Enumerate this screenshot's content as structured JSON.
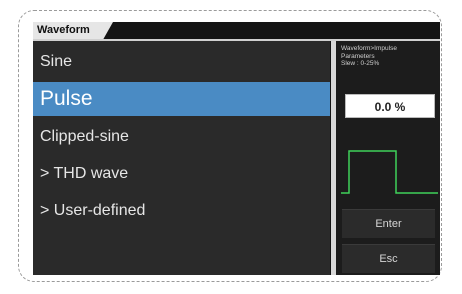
{
  "title": "Waveform",
  "menu": {
    "items": [
      {
        "label": "Sine"
      },
      {
        "label": "Pulse"
      },
      {
        "label": "Clipped-sine"
      },
      {
        "label": "> THD wave"
      },
      {
        "label": "> User-defined"
      }
    ],
    "selected": "Pulse"
  },
  "side": {
    "info_lines": [
      "Waveform>Impulse",
      "Parameters",
      "Slew : 0-25%"
    ],
    "value": "0.0 %",
    "enter_label": "Enter",
    "esc_label": "Esc"
  },
  "colors": {
    "accent": "#4a8bc4",
    "waveform": "#3fd25a"
  }
}
